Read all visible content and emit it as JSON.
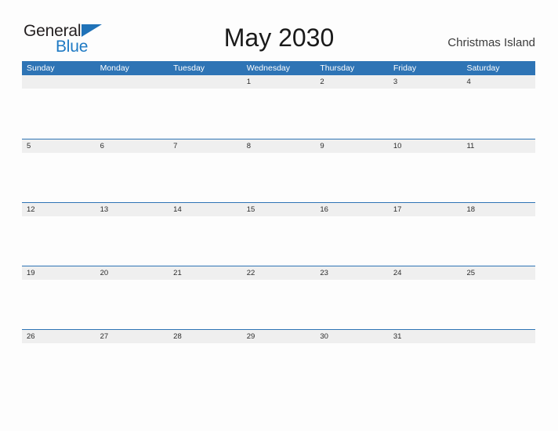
{
  "brand": {
    "name_part1": "General",
    "name_part2": "Blue",
    "flag_icon": "brand-flag-icon",
    "color_dark": "#231f20",
    "color_blue": "#1f7ac4"
  },
  "header": {
    "title": "May 2030",
    "month": "May",
    "year": "2030",
    "location": "Christmas Island"
  },
  "theme": {
    "header_blue": "#2e74b5",
    "date_band_gray": "#efefef",
    "page_background": "#fdfdfd",
    "text_dark": "#2b2b2b"
  },
  "weekdays": [
    "Sunday",
    "Monday",
    "Tuesday",
    "Wednesday",
    "Thursday",
    "Friday",
    "Saturday"
  ],
  "weeks": [
    {
      "days": [
        "",
        "",
        "",
        "1",
        "2",
        "3",
        "4"
      ]
    },
    {
      "days": [
        "5",
        "6",
        "7",
        "8",
        "9",
        "10",
        "11"
      ]
    },
    {
      "days": [
        "12",
        "13",
        "14",
        "15",
        "16",
        "17",
        "18"
      ]
    },
    {
      "days": [
        "19",
        "20",
        "21",
        "22",
        "23",
        "24",
        "25"
      ]
    },
    {
      "days": [
        "26",
        "27",
        "28",
        "29",
        "30",
        "31",
        ""
      ]
    }
  ]
}
